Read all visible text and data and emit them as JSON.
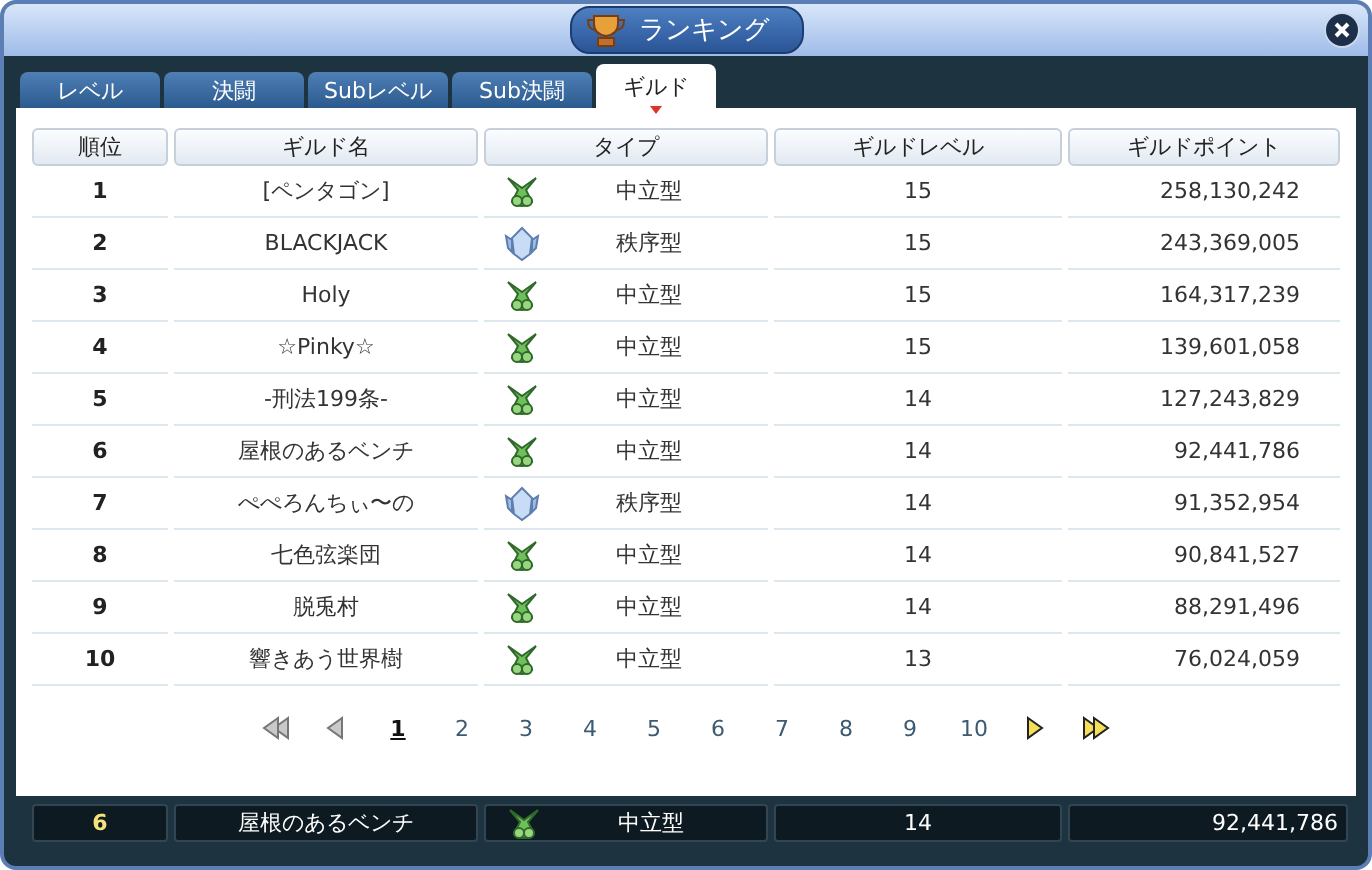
{
  "window": {
    "title": "ランキング"
  },
  "tabs": [
    {
      "label": "レベル",
      "selected": false
    },
    {
      "label": "決闘",
      "selected": false
    },
    {
      "label": "Subレベル",
      "selected": false
    },
    {
      "label": "Sub決闘",
      "selected": false
    },
    {
      "label": "ギルド",
      "selected": true
    }
  ],
  "table": {
    "columns": [
      "順位",
      "ギルド名",
      "タイプ",
      "ギルドレベル",
      "ギルドポイント"
    ],
    "rows": [
      {
        "rank": "1",
        "name": "[ペンタゴン]",
        "kind": "neutral",
        "type": "中立型",
        "level": "15",
        "points": "258,130,242"
      },
      {
        "rank": "2",
        "name": "BLACKJACK",
        "kind": "order",
        "type": "秩序型",
        "level": "15",
        "points": "243,369,005"
      },
      {
        "rank": "3",
        "name": "Holy",
        "kind": "neutral",
        "type": "中立型",
        "level": "15",
        "points": "164,317,239"
      },
      {
        "rank": "4",
        "name": "☆Pinky☆",
        "kind": "neutral",
        "type": "中立型",
        "level": "15",
        "points": "139,601,058"
      },
      {
        "rank": "5",
        "name": "-刑法199条-",
        "kind": "neutral",
        "type": "中立型",
        "level": "14",
        "points": "127,243,829"
      },
      {
        "rank": "6",
        "name": "屋根のあるベンチ",
        "kind": "neutral",
        "type": "中立型",
        "level": "14",
        "points": "92,441,786"
      },
      {
        "rank": "7",
        "name": "ぺぺろんちぃ〜の",
        "kind": "order",
        "type": "秩序型",
        "level": "14",
        "points": "91,352,954"
      },
      {
        "rank": "8",
        "name": "七色弦楽団",
        "kind": "neutral",
        "type": "中立型",
        "level": "14",
        "points": "90,841,527"
      },
      {
        "rank": "9",
        "name": "脱兎村",
        "kind": "neutral",
        "type": "中立型",
        "level": "14",
        "points": "88,291,496"
      },
      {
        "rank": "10",
        "name": "響きあう世界樹",
        "kind": "neutral",
        "type": "中立型",
        "level": "13",
        "points": "76,024,059"
      }
    ]
  },
  "pagination": {
    "first_disabled": true,
    "prev_disabled": true,
    "next_disabled": false,
    "last_disabled": false,
    "pages": [
      {
        "label": "1",
        "selected": true
      },
      {
        "label": "2",
        "selected": false
      },
      {
        "label": "3",
        "selected": false
      },
      {
        "label": "4",
        "selected": false
      },
      {
        "label": "5",
        "selected": false
      },
      {
        "label": "6",
        "selected": false
      },
      {
        "label": "7",
        "selected": false
      },
      {
        "label": "8",
        "selected": false
      },
      {
        "label": "9",
        "selected": false
      },
      {
        "label": "10",
        "selected": false
      }
    ]
  },
  "my_guild": {
    "rank": "6",
    "name": "屋根のあるベンチ",
    "kind": "neutral",
    "type": "中立型",
    "level": "14",
    "points": "92,441,786"
  }
}
